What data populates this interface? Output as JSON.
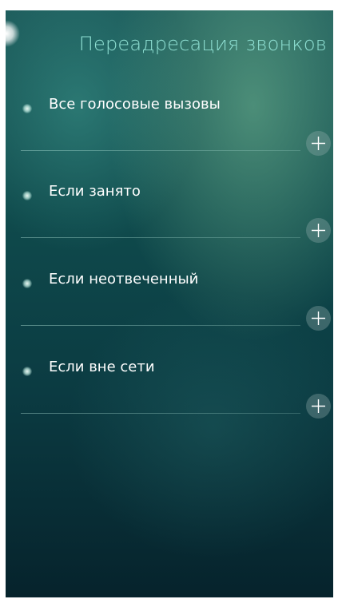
{
  "header": {
    "title": "Переадресация звонков"
  },
  "forwarding_options": [
    {
      "label": "Все голосовые вызовы",
      "action_icon": "plus-icon"
    },
    {
      "label": "Если занято",
      "action_icon": "plus-icon"
    },
    {
      "label": "Если неотвеченный",
      "action_icon": "plus-icon"
    },
    {
      "label": "Если вне сети",
      "action_icon": "plus-icon"
    }
  ],
  "colors": {
    "title": "#8fe0d3",
    "label": "#ffffff",
    "background_top": "#1c5a5a",
    "background_bottom": "#06232c"
  }
}
